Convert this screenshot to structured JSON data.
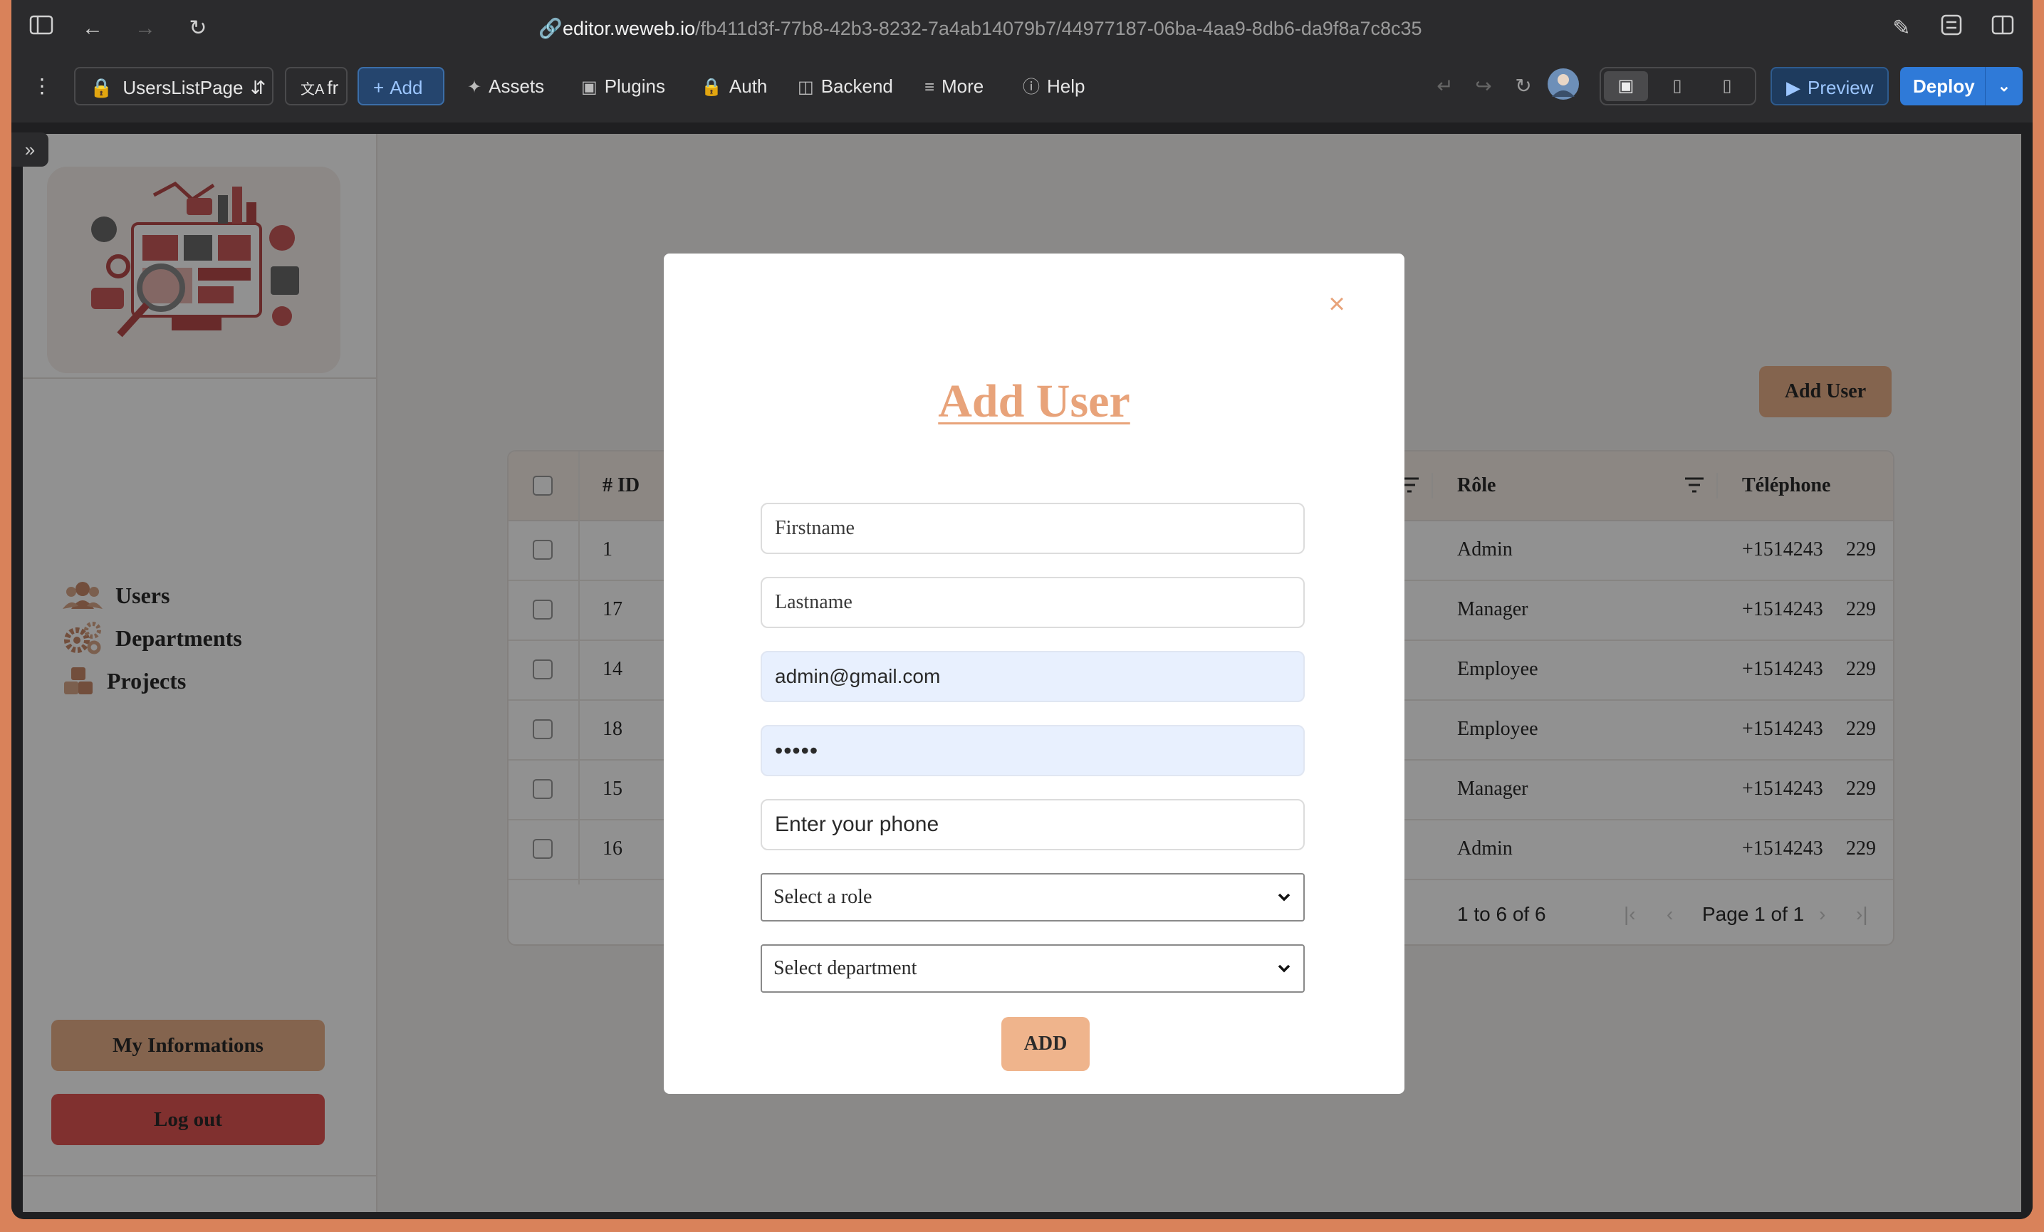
{
  "browser": {
    "url_host": "editor.weweb.io",
    "url_path": "/fb411d3f-77b8-42b3-8232-7a4ab14079b7/44977187-06ba-4aa9-8db6-da9f8a7c8c35"
  },
  "toolbar": {
    "page_selector": "UsersListPage",
    "language": "fr",
    "add": "Add",
    "assets": "Assets",
    "plugins": "Plugins",
    "auth": "Auth",
    "backend": "Backend",
    "more": "More",
    "help": "Help",
    "preview": "Preview",
    "deploy": "Deploy"
  },
  "sidebar": {
    "items": [
      {
        "label": "Users",
        "icon": "users-icon"
      },
      {
        "label": "Departments",
        "icon": "gears-icon"
      },
      {
        "label": "Projects",
        "icon": "boxes-icon"
      }
    ],
    "my_informations": "My  Informations",
    "logout": "Log  out"
  },
  "main": {
    "add_user_button": "Add  User",
    "table": {
      "headers": {
        "id": "# ID",
        "role": "Rôle",
        "phone": "Téléphone"
      },
      "rows": [
        {
          "id": "1",
          "frag": "",
          "role": "Admin",
          "phone": "+1514243",
          "phone_tail": "229"
        },
        {
          "id": "17",
          "frag": "",
          "role": "Manager",
          "phone": "+1514243",
          "phone_tail": "229"
        },
        {
          "id": "14",
          "frag": "..",
          "role": "Employee",
          "phone": "+1514243",
          "phone_tail": "229"
        },
        {
          "id": "18",
          "frag": "",
          "role": "Employee",
          "phone": "+1514243",
          "phone_tail": "229"
        },
        {
          "id": "15",
          "frag": "..",
          "role": "Manager",
          "phone": "+1514243",
          "phone_tail": "229"
        },
        {
          "id": "16",
          "frag": ":",
          "role": "Admin",
          "phone": "+1514243",
          "phone_tail": "229"
        }
      ],
      "pager": {
        "range": "1 to 6 of 6",
        "page": "Page 1 of 1"
      }
    }
  },
  "modal": {
    "title": "Add  User",
    "close": "×",
    "firstname_placeholder": "Firstname",
    "lastname_placeholder": "Lastname",
    "email_value": "admin@gmail.com",
    "password_value": "•••••",
    "phone_placeholder": "Enter your phone",
    "role_select": "Select  a  role",
    "department_select": "Select  department",
    "submit": "ADD"
  },
  "colors": {
    "accent": "#e8a37a",
    "button_brown": "#e8b08a",
    "logout_red": "#e25553",
    "deploy_blue": "#2f7ad8"
  }
}
